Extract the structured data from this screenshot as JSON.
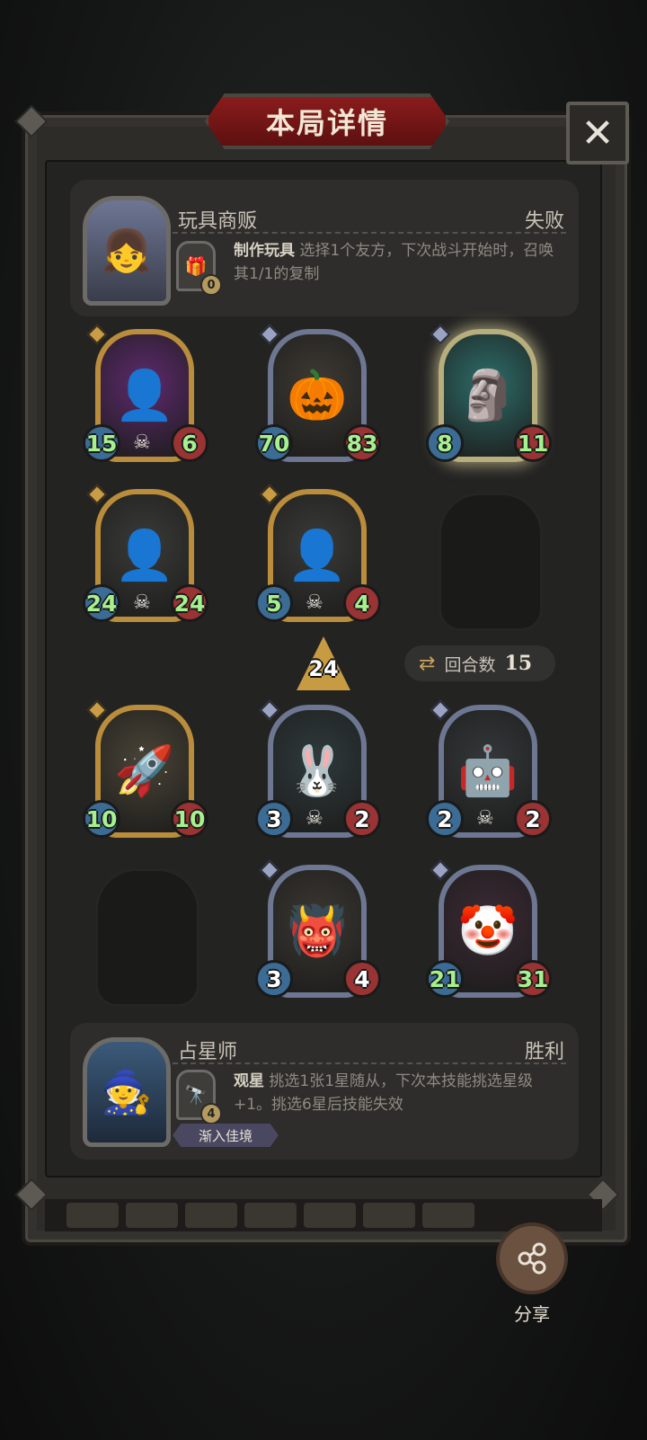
{
  "header": {
    "title": "本局详情",
    "close_icon": "close-icon"
  },
  "top_player": {
    "name": "玩具商贩",
    "result": "失败",
    "portrait": "👧",
    "skill": {
      "name": "制作玩具",
      "desc": "选择1个友方，下次战斗开始时，召唤其1/1的复制",
      "badge": "0",
      "icon": "🎁"
    }
  },
  "top_board": [
    {
      "atk": "15",
      "hp": "6",
      "icon": "👤",
      "skull": true,
      "frame": "gold",
      "bg": "#5e2a6e"
    },
    {
      "atk": "70",
      "hp": "83",
      "icon": "🎃",
      "skull": false,
      "frame": "silver",
      "bg": "#3e3a33"
    },
    {
      "atk": "8",
      "hp": "11",
      "icon": "🗿",
      "skull": false,
      "frame": "glow",
      "bg": "#2d6e6a"
    },
    {
      "atk": "24",
      "hp": "24",
      "icon": "👤",
      "skull": true,
      "frame": "gold",
      "bg": "#3a3a38"
    },
    {
      "atk": "5",
      "hp": "4",
      "icon": "👤",
      "skull": true,
      "frame": "gold",
      "bg": "#3a3a38"
    }
  ],
  "damage_indicator": "24",
  "rounds": {
    "label": "回合数",
    "value": "15"
  },
  "bottom_board": [
    {
      "atk": "10",
      "hp": "10",
      "icon": "🚀",
      "skull": false,
      "frame": "gold",
      "bg": "#4a4437"
    },
    {
      "atk": "3",
      "hp": "2",
      "icon": "🐰",
      "skull": true,
      "frame": "silver",
      "bg": "#2f3a3c"
    },
    {
      "atk": "2",
      "hp": "2",
      "icon": "🤖",
      "skull": true,
      "frame": "silver",
      "bg": "#34383a"
    },
    {
      "atk": "3",
      "hp": "4",
      "icon": "👹",
      "skull": false,
      "frame": "silver",
      "bg": "#3c3832"
    },
    {
      "atk": "21",
      "hp": "31",
      "icon": "🤡",
      "skull": false,
      "frame": "silver",
      "bg": "#3c2a35"
    }
  ],
  "bottom_player": {
    "name": "占星师",
    "result": "胜利",
    "portrait": "🧙",
    "skill": {
      "name": "观星",
      "desc": "挑选1张1星随从，下次本技能挑选星级+1。挑选6星后技能失效",
      "badge": "4",
      "icon": "🔭"
    },
    "tag": "渐入佳境"
  },
  "share": {
    "label": "分享",
    "icon": "share-icon"
  }
}
